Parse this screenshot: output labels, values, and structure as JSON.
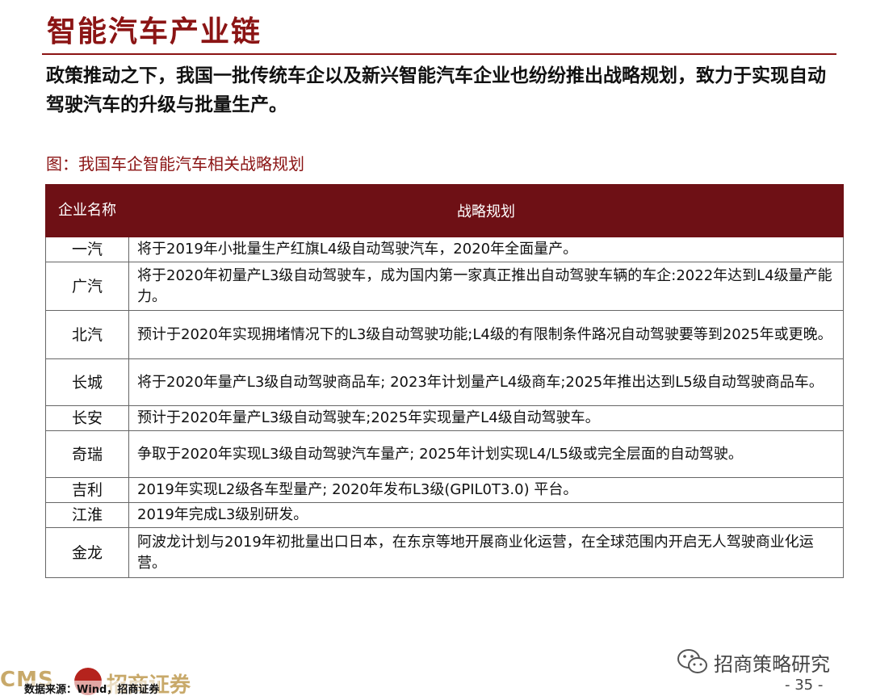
{
  "title": "智能汽车产业链",
  "intro": "政策推动之下，我国一批传统车企以及新兴智能汽车企业也纷纷推出战略规划，致力于实现自动驾驶汽车的升级与批量生产。",
  "figure_caption": "图：我国车企智能汽车相关战略规划",
  "table": {
    "headers": {
      "company": "企业名称",
      "strategy": "战略规划"
    },
    "rows": [
      {
        "company": "一汽",
        "strategy": "将于2019年小批量生产红旗L4级自动驾驶汽车，2020年全面量产。"
      },
      {
        "company": "广汽",
        "strategy": "将于2020年初量产L3级自动驾驶车，成为国内第一家真正推出自动驾驶车辆的车企:2022年达到L4级量产能力。"
      },
      {
        "company": "北汽",
        "strategy": "预计于2020年实现拥堵情况下的L3级自动驾驶功能;L4级的有限制条件路况自动驾驶要等到2025年或更晚。"
      },
      {
        "company": "长城",
        "strategy": "将于2020年量产L3级自动驾驶商品车; 2023年计划量产L4级商车;2025年推出达到L5级自动驾驶商品车。"
      },
      {
        "company": "长安",
        "strategy": "预计于2020年量产L3级自动驾驶车;2025年实现量产L4级自动驾驶车。"
      },
      {
        "company": "奇瑞",
        "strategy": "争取于2020年实现L3级自动驾驶汽车量产; 2025年计划实现L4/L5级或完全层面的自动驾驶。"
      },
      {
        "company": "吉利",
        "strategy": "2019年实现L2级各车型量产; 2020年发布L3级(GPIL0T3.0) 平台。"
      },
      {
        "company": "江淮",
        "strategy": "2019年完成L3级别研发。"
      },
      {
        "company": "金龙",
        "strategy": "阿波龙计划与2019年初批量出口日本，在东京等地开展商业化运营，在全球范围内开启无人驾驶商业化运营。"
      }
    ]
  },
  "footer": {
    "source": "数据来源：Wind，招商证券",
    "logo_en": "CMS",
    "logo_cn": "招商证券",
    "wechat_account": "招商策略研究",
    "page_number": "- 35 -"
  },
  "colors": {
    "brand": "#8b1414",
    "header_bg": "#6e1015"
  }
}
